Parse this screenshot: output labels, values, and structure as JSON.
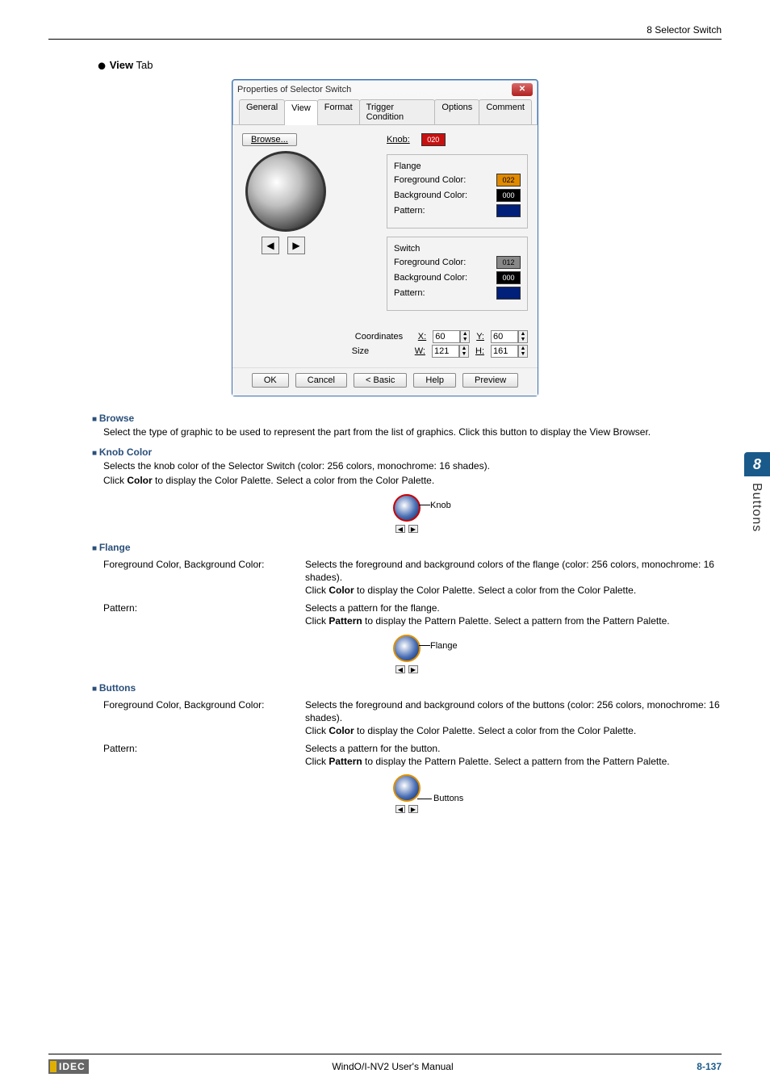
{
  "header": {
    "right": "8 Selector Switch"
  },
  "title": {
    "bullet": "●",
    "bold": "View",
    "rest": " Tab"
  },
  "dialog": {
    "title": "Properties of Selector Switch",
    "tabs": [
      "General",
      "View",
      "Format",
      "Trigger Condition",
      "Options",
      "Comment"
    ],
    "activeTab": 1,
    "browse": "Browse...",
    "knob": {
      "label": "Knob:",
      "value": "020"
    },
    "flange": {
      "legend": "Flange",
      "fg_label": "Foreground Color:",
      "fg_value": "022",
      "bg_label": "Background Color:",
      "bg_value": "000",
      "pattern_label": "Pattern:"
    },
    "switch": {
      "legend": "Switch",
      "fg_label": "Foreground Color:",
      "fg_value": "012",
      "bg_label": "Background Color:",
      "bg_value": "000",
      "pattern_label": "Pattern:"
    },
    "coords": {
      "row1_label": "Coordinates",
      "x_label": "X:",
      "x": "60",
      "y_label": "Y:",
      "y": "60",
      "row2_label": "Size",
      "w_label": "W:",
      "w": "121",
      "h_label": "H:",
      "h": "161"
    },
    "buttons": {
      "ok": "OK",
      "cancel": "Cancel",
      "basic": "< Basic",
      "help": "Help",
      "preview": "Preview"
    }
  },
  "sections": {
    "browse": {
      "heading": "Browse",
      "body": "Select the type of graphic to be used to represent the part from the list of graphics. Click this button to display the View Browser."
    },
    "knobColor": {
      "heading": "Knob Color",
      "body_a": "Selects the knob color of the Selector Switch (color: 256 colors, monochrome: 16 shades).",
      "body_b_pre": "Click ",
      "body_b_bold": "Color",
      "body_b_post": " to display the Color Palette. Select a color from the Color Palette.",
      "fig_label": "Knob"
    },
    "flange": {
      "heading": "Flange",
      "row1_l": "Foreground Color, Background Color:",
      "row1_r_a": "Selects the foreground and background colors of the flange (color: 256 colors, monochrome: 16 shades).",
      "row1_r_b_pre": "Click ",
      "row1_r_b_bold": "Color",
      "row1_r_b_post": " to display the Color Palette. Select a color from the Color Palette.",
      "row2_l": "Pattern:",
      "row2_r_a": "Selects a pattern for the flange.",
      "row2_r_b_pre": "Click ",
      "row2_r_b_bold": "Pattern",
      "row2_r_b_post": " to display the Pattern Palette. Select a pattern from the Pattern Palette.",
      "fig_label": "Flange"
    },
    "buttonsSec": {
      "heading": "Buttons",
      "row1_l": "Foreground Color, Background Color:",
      "row1_r_a": "Selects the foreground and background colors of the buttons (color: 256 colors, monochrome: 16 shades).",
      "row1_r_b_pre": "Click ",
      "row1_r_b_bold": "Color",
      "row1_r_b_post": " to display the Color Palette. Select a color from the Color Palette.",
      "row2_l": "Pattern:",
      "row2_r_a": "Selects a pattern for the button.",
      "row2_r_b_pre": "Click ",
      "row2_r_b_bold": "Pattern",
      "row2_r_b_post": " to display the Pattern Palette. Select a pattern from the Pattern Palette.",
      "fig_label": "Buttons"
    }
  },
  "sidetab": {
    "num": "8",
    "text": "Buttons"
  },
  "footer": {
    "logo": "IDEC",
    "center": "WindO/I-NV2 User's Manual",
    "page": "8-137"
  }
}
